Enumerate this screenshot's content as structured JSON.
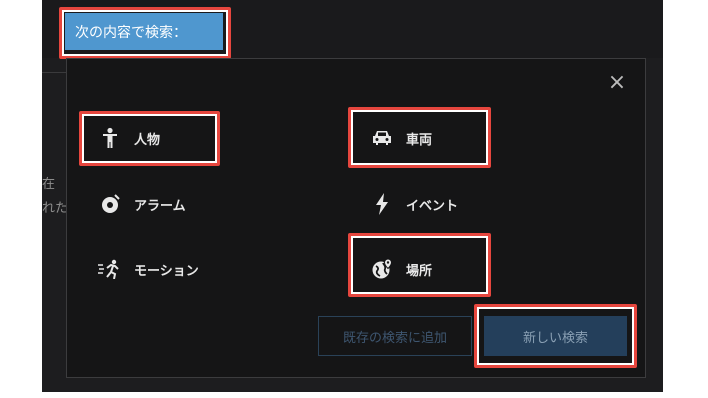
{
  "search_by_label": "次の内容で検索：",
  "background_text": {
    "line1": "在",
    "line2": "れた"
  },
  "close_glyph": "×",
  "options": {
    "person": "人物",
    "vehicle": "車両",
    "alarm": "アラーム",
    "event": "イベント",
    "motion": "モーション",
    "location": "場所"
  },
  "buttons": {
    "add_existing": "既存の検索に追加",
    "new_search": "新しい検索"
  },
  "colors": {
    "accent": "#4f97cf",
    "highlight": "#e6463e",
    "dialog_bg": "#151516"
  },
  "icons": {
    "person": "person-icon",
    "vehicle": "car-icon",
    "alarm": "alarm-icon",
    "event": "lightning-icon",
    "motion": "running-person-icon",
    "location": "globe-pin-icon"
  }
}
